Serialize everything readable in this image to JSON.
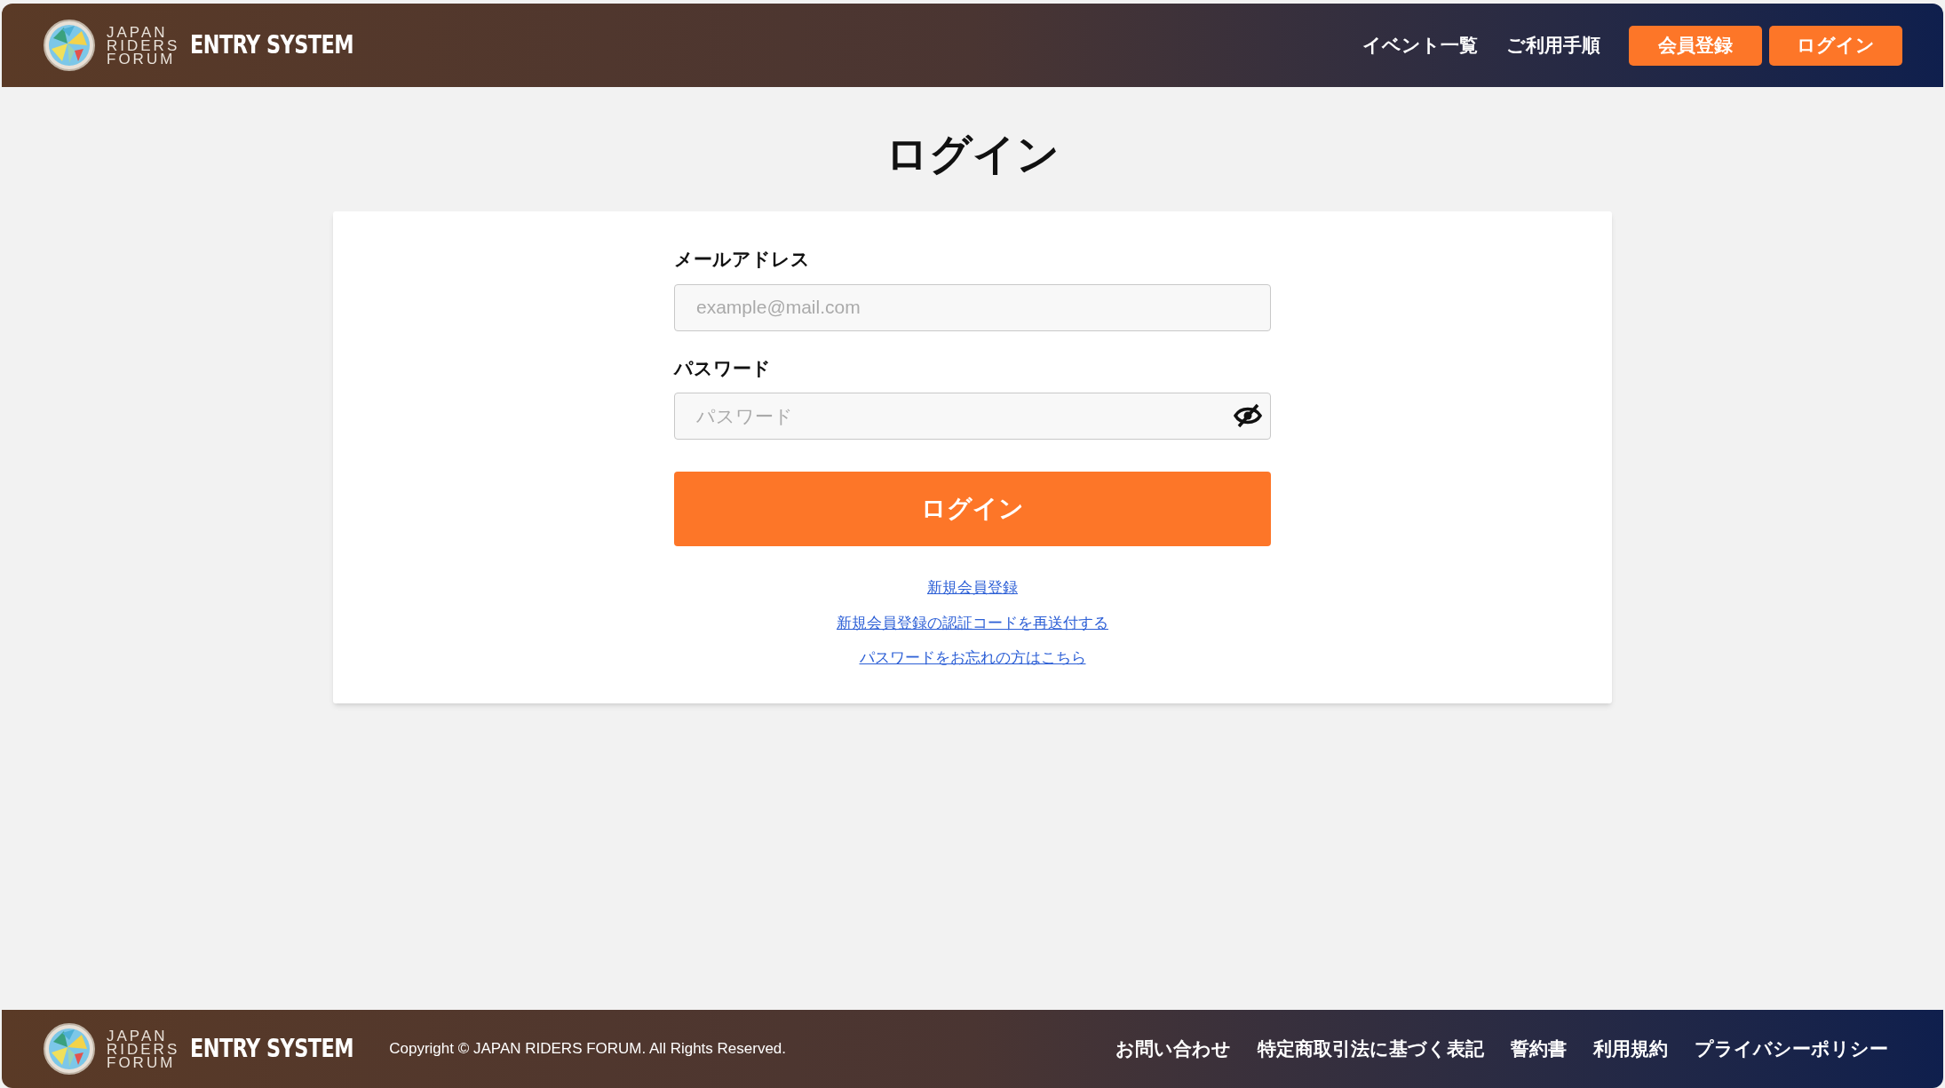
{
  "header": {
    "logo_lines": [
      "JAPAN",
      "RIDERS",
      "FORUM"
    ],
    "brand": "ENTRY SYSTEM",
    "nav": [
      "イベント一覧",
      "ご利用手順"
    ],
    "buttons": [
      "会員登録",
      "ログイン"
    ]
  },
  "page_title": "ログイン",
  "form": {
    "email": {
      "label": "メールアドレス",
      "placeholder": "example@mail.com"
    },
    "password": {
      "label": "パスワード",
      "placeholder": "パスワード"
    },
    "submit": "ログイン",
    "links": [
      "新規会員登録",
      "新規会員登録の認証コードを再送付する",
      "パスワードをお忘れの方はこちら"
    ]
  },
  "footer": {
    "logo_lines": [
      "JAPAN",
      "RIDERS",
      "FORUM"
    ],
    "brand": "ENTRY SYSTEM",
    "copyright": "Copyright © JAPAN RIDERS FORUM. All Rights Reserved.",
    "links": [
      "お問い合わせ",
      "特定商取引法に基づく表記",
      "誓約書",
      "利用規約",
      "プライバシーポリシー"
    ]
  }
}
